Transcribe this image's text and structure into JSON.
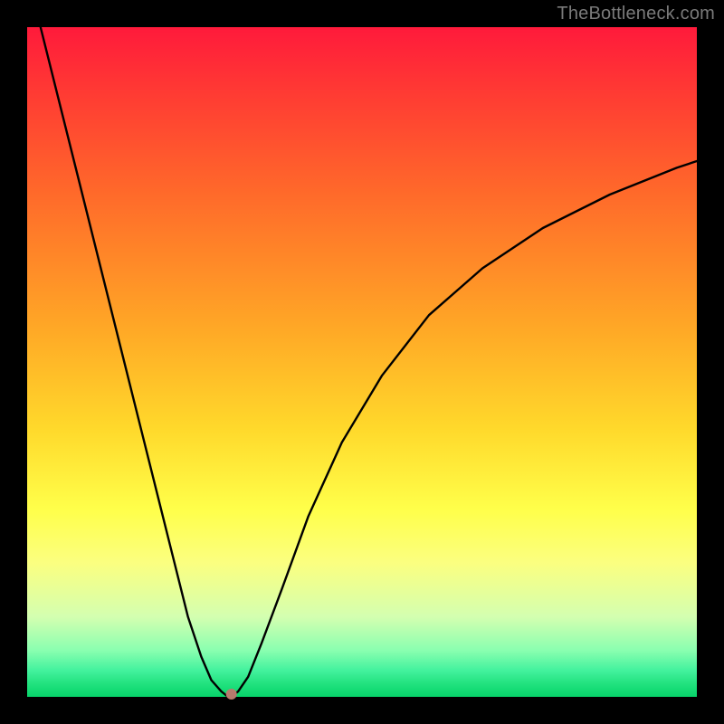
{
  "watermark": "TheBottleneck.com",
  "chart_data": {
    "type": "line",
    "title": "",
    "xlabel": "",
    "ylabel": "",
    "xlim": [
      0,
      100
    ],
    "ylim": [
      0,
      100
    ],
    "grid": false,
    "legend": false,
    "background_gradient": [
      "#ff1a3b",
      "#ffd92b",
      "#07d46a"
    ],
    "series": [
      {
        "name": "bottleneck-curve",
        "color": "#000000",
        "x": [
          2,
          5,
          8,
          11,
          14,
          17,
          20,
          22,
          24,
          26,
          27.5,
          29,
          30,
          30.5,
          31.5,
          33,
          35,
          38,
          42,
          47,
          53,
          60,
          68,
          77,
          87,
          97,
          100
        ],
        "y": [
          100,
          88,
          76,
          64,
          52,
          40,
          28,
          20,
          12,
          6,
          2.5,
          0.8,
          0,
          0,
          0.8,
          3,
          8,
          16,
          27,
          38,
          48,
          57,
          64,
          70,
          75,
          79,
          80
        ]
      }
    ],
    "annotations": [
      {
        "name": "minimum-marker",
        "x": 30.5,
        "y": 0.4,
        "color": "#b77a6d"
      }
    ]
  }
}
